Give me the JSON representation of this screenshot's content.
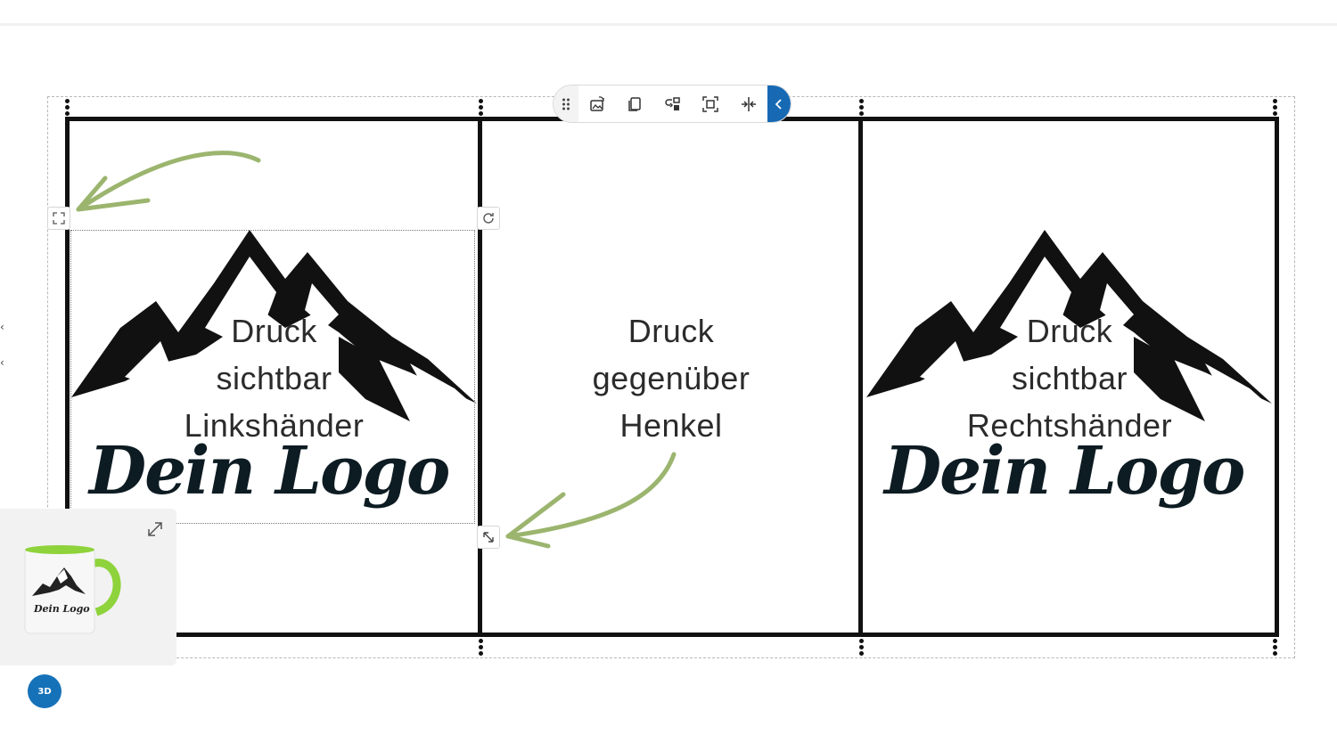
{
  "editor": {
    "toolbar": {
      "drag_icon": "drag-handle-icon",
      "replace_icon": "replace-image-icon",
      "duplicate_icon": "duplicate-icon",
      "swap_icon": "swap-icon",
      "fit_icon": "fit-to-area-icon",
      "center_icon": "center-horizontal-icon",
      "collapse_icon": "chevron-left-icon",
      "collapse_color": "#1769b3"
    },
    "zones": {
      "left": {
        "label_1": "Druck",
        "label_2": "sichtbar",
        "label_3": "Linkshänder",
        "logo_text": "Dein Logo"
      },
      "center": {
        "label_1": "Druck",
        "label_2": "gegenüber",
        "label_3": "Henkel"
      },
      "right": {
        "label_1": "Druck",
        "label_2": "sichtbar",
        "label_3": "Rechtshänder",
        "logo_text": "Dein Logo"
      }
    },
    "preview": {
      "mug_logo_text": "Dein Logo",
      "mug_accent": "#8ed33b",
      "button_3d": "3D",
      "button_3d_color": "#1672b8"
    },
    "annotation_color": "#9bb56e"
  }
}
